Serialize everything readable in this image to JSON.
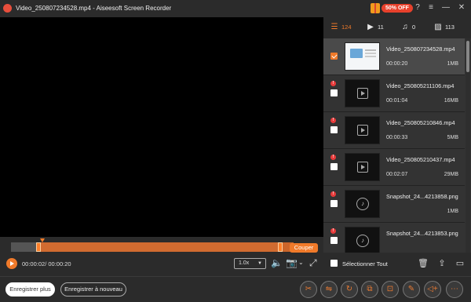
{
  "window": {
    "title": "Video_250807234528.mp4  -  Aiseesoft Screen Recorder",
    "promo_badge": "50% OFF"
  },
  "player": {
    "time": "00:00:02/ 00:00:20",
    "cut_label": "Couper",
    "speed": "1.0x",
    "progress": 0.1
  },
  "tabs": [
    {
      "icon": "list-icon",
      "count": "124",
      "active": true
    },
    {
      "icon": "video-icon",
      "count": "11",
      "active": false
    },
    {
      "icon": "music-icon",
      "count": "0",
      "active": false
    },
    {
      "icon": "image-icon",
      "count": "113",
      "active": false
    }
  ],
  "files": [
    {
      "name": "Video_250807234528.mp4",
      "duration": "00:00:20",
      "size": "1MB",
      "kind": "video",
      "thumb": "web",
      "checked": true,
      "warning": false
    },
    {
      "name": "Video_250805211106.mp4",
      "duration": "00:01:04",
      "size": "16MB",
      "kind": "video",
      "thumb": "video",
      "checked": false,
      "warning": true
    },
    {
      "name": "Video_250805210846.mp4",
      "duration": "00:00:33",
      "size": "5MB",
      "kind": "video",
      "thumb": "video",
      "checked": false,
      "warning": true
    },
    {
      "name": "Video_250805210437.mp4",
      "duration": "00:02:07",
      "size": "29MB",
      "kind": "video",
      "thumb": "video",
      "checked": false,
      "warning": true
    },
    {
      "name": "Snapshot_24...4213858.png",
      "duration": "",
      "size": "1MB",
      "kind": "image",
      "thumb": "audio",
      "checked": false,
      "warning": true
    },
    {
      "name": "Snapshot_24...4213853.png",
      "duration": "",
      "size": "",
      "kind": "image",
      "thumb": "audio",
      "checked": false,
      "warning": true
    }
  ],
  "panel_footer": {
    "select_all_label": "Sélectionner Tout"
  },
  "bottom": {
    "record_more_label": "Enregistrer plus",
    "record_new_label": "Enregistrer à nouveau"
  },
  "colors": {
    "accent": "#f07a2a",
    "warning": "#e83b3b",
    "background": "#2b2b2b"
  }
}
